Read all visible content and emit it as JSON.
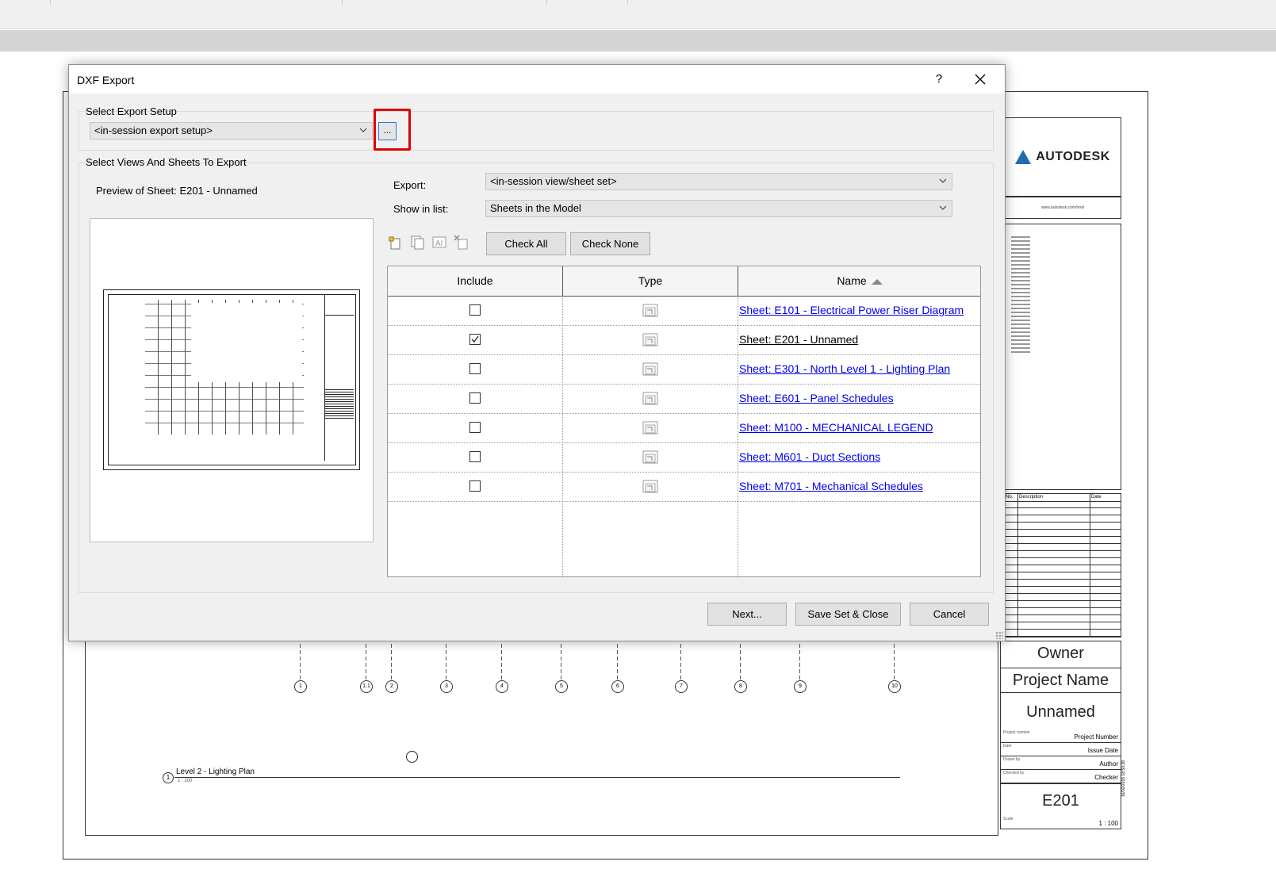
{
  "sheet": {
    "logo_text": "AUTODESK",
    "website": "www.autodesk.com/revit",
    "revision_headers": [
      "No.",
      "Description",
      "Date"
    ],
    "owner": "Owner",
    "project_name": "Project Name",
    "sheet_name": "Unnamed",
    "rows": [
      {
        "label": "Project number",
        "value": "Project Number"
      },
      {
        "label": "Date",
        "value": "Issue Date"
      },
      {
        "label": "Drawn by",
        "value": "Author"
      },
      {
        "label": "Checked by",
        "value": "Checker"
      }
    ],
    "sheet_number": "E201",
    "scale_label": "Scale",
    "scale_value": "1 : 100",
    "vertical_stamp": "16/02/2016 18:50:28",
    "level_number": "1",
    "level_title": "Level 2 - Lighting Plan",
    "level_scale": "1 : 100",
    "grid_labels": [
      "1",
      "1.1",
      "2",
      "3",
      "4",
      "5",
      "6",
      "7",
      "8",
      "9",
      "10"
    ]
  },
  "dialog": {
    "title": "DXF Export",
    "help_label": "?",
    "setup_group_label": "Select Export Setup",
    "setup_value": "<in-session export setup>",
    "dots_label": "...",
    "views_group_label": "Select Views And Sheets To Export",
    "preview_label": "Preview of Sheet: E201 - Unnamed",
    "export_label": "Export:",
    "export_value": "<in-session view/sheet set>",
    "show_label": "Show in list:",
    "show_value": "Sheets in the Model",
    "check_all": "Check All",
    "check_none": "Check None",
    "columns": [
      "Include",
      "Type",
      "Name"
    ],
    "rows": [
      {
        "checked": false,
        "name": "Sheet: E101 - Electrical Power Riser Diagram"
      },
      {
        "checked": true,
        "name": "Sheet: E201 - Unnamed"
      },
      {
        "checked": false,
        "name": "Sheet: E301 - North Level 1 - Lighting Plan"
      },
      {
        "checked": false,
        "name": "Sheet: E601 - Panel Schedules"
      },
      {
        "checked": false,
        "name": "Sheet: M100 - MECHANICAL LEGEND"
      },
      {
        "checked": false,
        "name": "Sheet: M601 - Duct Sections"
      },
      {
        "checked": false,
        "name": "Sheet: M701 - Mechanical Schedules"
      }
    ],
    "next_label": "Next...",
    "save_label": "Save Set & Close",
    "cancel_label": "Cancel"
  },
  "colors": {
    "link": "#0000ee",
    "highlight": "#e00000",
    "focus": "#2b78d4",
    "autodesk_blue": "#1f6cb5"
  }
}
